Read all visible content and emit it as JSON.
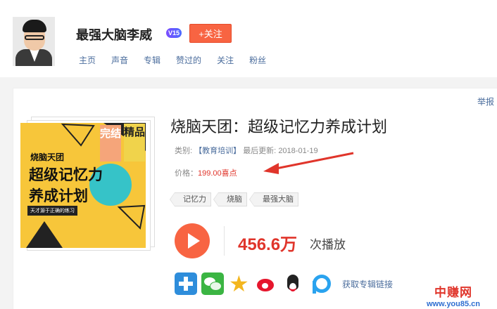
{
  "profile": {
    "username": "最强大脑李威",
    "level_badge": "V15",
    "follow_label": "+关注"
  },
  "nav": {
    "items": [
      "主页",
      "声音",
      "专辑",
      "赞过的",
      "关注",
      "粉丝"
    ]
  },
  "report_label": "举报",
  "cover": {
    "small_title": "烧脑天团",
    "title_line1": "超级记忆力",
    "title_line2": "养成计划",
    "subtitle": "天才源于正确的练习",
    "tag_done": "完结",
    "tag_fine": "精品"
  },
  "album": {
    "title": "烧脑天团：超级记忆力养成计划",
    "category_label": "类别:",
    "category": "【教育培训】",
    "updated_label": "最后更新:",
    "updated_date": "2018-01-19",
    "price_label": "价格：",
    "price": "199.00喜点",
    "tags": [
      "记忆力",
      "烧脑",
      "最强大脑"
    ],
    "plays": "456.6万",
    "plays_label": "次播放"
  },
  "share": {
    "icons": [
      "plus-share-icon",
      "wechat-icon",
      "qzone-icon",
      "weibo-icon",
      "qq-icon",
      "pin-icon"
    ],
    "get_link_label": "获取专辑链接"
  },
  "watermark": {
    "name": "中赚网",
    "url": "www.you85.cn"
  },
  "colors": {
    "accent": "#f86442",
    "link": "#4a6c9c",
    "price": "#e0352b",
    "cover_bg": "#f7c63a"
  }
}
